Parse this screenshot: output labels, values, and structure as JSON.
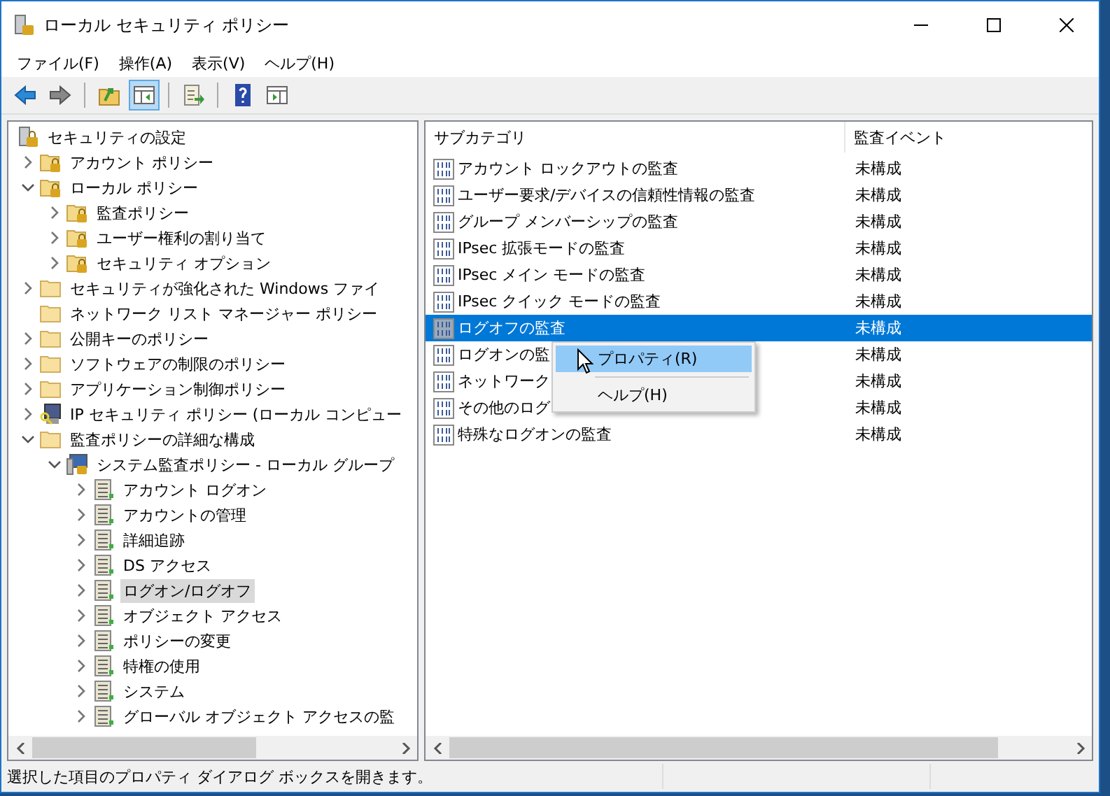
{
  "window": {
    "title": "ローカル セキュリティ ポリシー"
  },
  "menu": [
    "ファイル(F)",
    "操作(A)",
    "表示(V)",
    "ヘルプ(H)"
  ],
  "toolbar": [
    {
      "kind": "back",
      "pressed": false
    },
    {
      "kind": "forward",
      "pressed": false
    },
    {
      "kind": "separator"
    },
    {
      "kind": "up",
      "pressed": false
    },
    {
      "kind": "tree",
      "pressed": true
    },
    {
      "kind": "separator"
    },
    {
      "kind": "export",
      "pressed": false
    },
    {
      "kind": "separator"
    },
    {
      "kind": "help",
      "pressed": false
    },
    {
      "kind": "action",
      "pressed": false
    }
  ],
  "tree": [
    {
      "label": "セキュリティの設定",
      "kind": "root",
      "selected": false,
      "children": [
        {
          "label": "アカウント ポリシー",
          "kind": "folder-lock",
          "expanded": false,
          "selected": false
        },
        {
          "label": "ローカル ポリシー",
          "kind": "folder-lock",
          "expanded": true,
          "selected": false,
          "children": [
            {
              "label": "監査ポリシー",
              "kind": "folder-lock",
              "expanded": false,
              "selected": false
            },
            {
              "label": "ユーザー権利の割り当て",
              "kind": "folder-lock",
              "expanded": false,
              "selected": false
            },
            {
              "label": "セキュリティ オプション",
              "kind": "folder-lock",
              "expanded": false,
              "selected": false
            }
          ]
        },
        {
          "label": "セキュリティが強化された Windows ファイ",
          "kind": "folder",
          "expanded": false,
          "selected": false
        },
        {
          "label": "ネットワーク リスト マネージャー ポリシー",
          "kind": "folder",
          "selected": false
        },
        {
          "label": "公開キーのポリシー",
          "kind": "folder",
          "expanded": false,
          "selected": false
        },
        {
          "label": "ソフトウェアの制限のポリシー",
          "kind": "folder",
          "expanded": false,
          "selected": false
        },
        {
          "label": "アプリケーション制御ポリシー",
          "kind": "folder",
          "expanded": false,
          "selected": false
        },
        {
          "label": "IP セキュリティ ポリシー (ローカル コンピュー",
          "kind": "computer-key",
          "expanded": false,
          "selected": false
        },
        {
          "label": "監査ポリシーの詳細な構成",
          "kind": "folder",
          "expanded": true,
          "selected": false,
          "children": [
            {
              "label": "システム監査ポリシー - ローカル グループ",
              "kind": "audit-root",
              "expanded": true,
              "selected": false,
              "children": [
                {
                  "label": "アカウント ログオン",
                  "kind": "audit",
                  "expanded": false,
                  "selected": false
                },
                {
                  "label": "アカウントの管理",
                  "kind": "audit",
                  "expanded": false,
                  "selected": false
                },
                {
                  "label": "詳細追跡",
                  "kind": "audit",
                  "expanded": false,
                  "selected": false
                },
                {
                  "label": "DS アクセス",
                  "kind": "audit",
                  "expanded": false,
                  "selected": false
                },
                {
                  "label": "ログオン/ログオフ",
                  "kind": "audit",
                  "expanded": false,
                  "selected": true
                },
                {
                  "label": "オブジェクト アクセス",
                  "kind": "audit",
                  "expanded": false,
                  "selected": false
                },
                {
                  "label": "ポリシーの変更",
                  "kind": "audit",
                  "expanded": false,
                  "selected": false
                },
                {
                  "label": "特権の使用",
                  "kind": "audit",
                  "expanded": false,
                  "selected": false
                },
                {
                  "label": "システム",
                  "kind": "audit",
                  "expanded": false,
                  "selected": false
                },
                {
                  "label": "グローバル オブジェクト アクセスの監",
                  "kind": "audit",
                  "expanded": false,
                  "selected": false
                }
              ]
            }
          ]
        }
      ]
    }
  ],
  "table": {
    "columns": [
      "サブカテゴリ",
      "監査イベント"
    ],
    "rows": [
      {
        "subcategory": "アカウント ロックアウトの監査",
        "event": "未構成",
        "selected": false
      },
      {
        "subcategory": "ユーザー要求/デバイスの信頼性情報の監査",
        "event": "未構成",
        "selected": false
      },
      {
        "subcategory": "グループ メンバーシップの監査",
        "event": "未構成",
        "selected": false
      },
      {
        "subcategory": "IPsec 拡張モードの監査",
        "event": "未構成",
        "selected": false
      },
      {
        "subcategory": "IPsec メイン モードの監査",
        "event": "未構成",
        "selected": false
      },
      {
        "subcategory": "IPsec クイック モードの監査",
        "event": "未構成",
        "selected": false
      },
      {
        "subcategory": "ログオフの監査",
        "event": "未構成",
        "selected": true
      },
      {
        "subcategory": "ログオンの監",
        "event": "未構成",
        "selected": false
      },
      {
        "subcategory": "ネットワーク",
        "event": "未構成",
        "selected": false
      },
      {
        "subcategory": "その他のログ",
        "event": "未構成",
        "selected": false
      },
      {
        "subcategory": "特殊なログオンの監査",
        "event": "未構成",
        "selected": false
      }
    ]
  },
  "context_menu": [
    {
      "kind": "item",
      "label": "プロパティ(R)",
      "selected": true
    },
    {
      "kind": "separator"
    },
    {
      "kind": "item",
      "label": "ヘルプ(H)",
      "selected": false
    }
  ],
  "status_bar": {
    "text": "選択した項目のプロパティ ダイアログ ボックスを開きます。"
  }
}
